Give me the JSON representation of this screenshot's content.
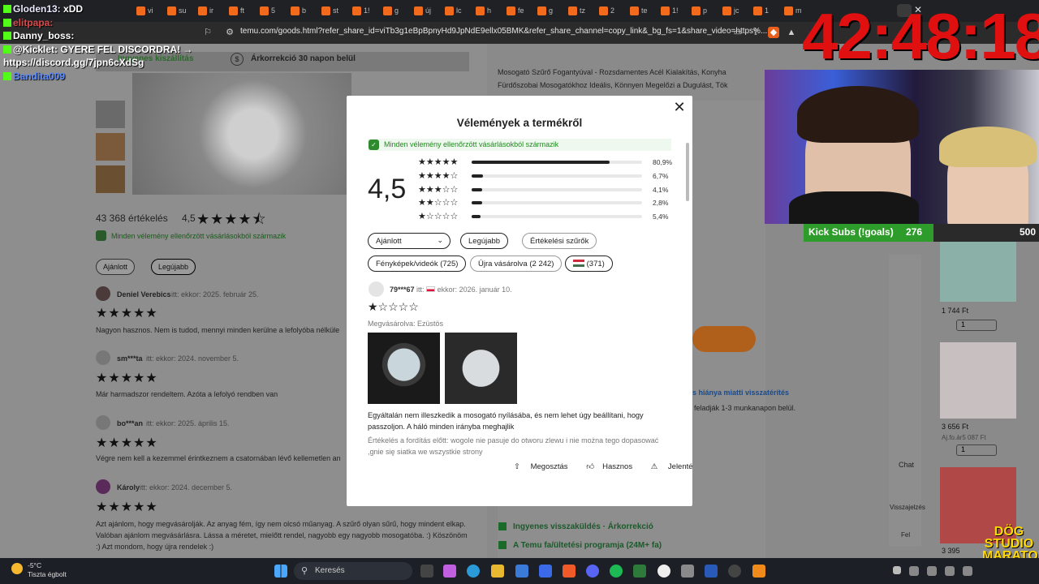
{
  "browser": {
    "tabs": [
      "vi",
      "su",
      "ir",
      "ft",
      "5",
      "b",
      "st",
      "1!",
      "g",
      "új",
      "lc",
      "h",
      "fe",
      "g",
      "tz",
      "2",
      "te",
      "1!",
      "p",
      "jc",
      "1",
      "m"
    ],
    "url": "temu.com/goods.html?refer_share_id=viTb3g1eBpBpnyHd9JpNdE9ellx05BMK&refer_share_channel=copy_link&_bg_fs=1&share_video=https%..."
  },
  "page_bg": {
    "shipping": "Ingyenes kiszállítás",
    "price_adjust": "Árkorrekció 30 napon belül",
    "desc_line1": "Mosogató Szűrő Fogantyúval - Rozsdamentes Acél Kialakítás, Konyha",
    "desc_line2": "Fürdőszobai Mosogatókhoz Ideális, Könnyen Megelőzi a Dugulást, Tök",
    "ratings_count": "43 368 értékelés",
    "rating_value": "4,5",
    "verified_note": "Minden vélemény ellenőrzött vásárlásokból származik",
    "filter_recommended": "Ajánlott",
    "filter_latest": "Legújabb",
    "reviews": [
      {
        "user": "Deniel Verebics",
        "meta": "itt:  ekkor: 2025. február 25.",
        "text": "Nagyon hasznos. Nem is tudod, mennyi minden kerülne a lefolyóba nélküle"
      },
      {
        "user": "sm***ta",
        "meta": "itt:  ekkor: 2024. november 5.",
        "text": "Már harmadszor rendeltem. Azóta a lefolyó rendben van"
      },
      {
        "user": "bo***an",
        "meta": "itt:  ekkor: 2025. április 15.",
        "text": "Végre nem kell a kezemmel érintkeznem a csatornában lévő kellemetlen an"
      },
      {
        "user": "Károly",
        "meta": "itt:  ekkor: 2024. december 5.",
        "text": "Azt ajánlom, hogy megvásárolják. Az anyag fém, így nem olcsó műanyag. A szűrő olyan sűrű, hogy mindent elkap. Valóban ajánlom megvásárlásra. Lássa a méretet, mielőtt rendel, nagyobb egy nagyobb mosogatóba. :) Köszönöm :) Azt mondom, hogy újra rendelek :)"
      }
    ],
    "free_return": "Ingyenes visszaküldés · Árkorrekció",
    "affiliate": "A Temu fa/ültetési programja (24M+ fa)",
    "return_note": "s hiánya miatti visszatérítés",
    "return_sub": "feladják 1-3 munkanapon belül.",
    "side_prices": [
      "1 744 Ft",
      "3 656 Ft",
      "3 395"
    ],
    "side_old_price": "Aj.fo.ár5 087 Ft",
    "qty": "1",
    "side_buttons": [
      "Chat",
      "Visszajelzés",
      "Fel"
    ]
  },
  "stream": {
    "chat": [
      {
        "name": "Gloden13:",
        "msg": "xDD"
      },
      {
        "name": "elitpapa:",
        "msg": ""
      },
      {
        "name": "Danny_boss:",
        "msg": ""
      },
      {
        "name": "@Kicklet:",
        "msg": "GYERE FEL DISCORDRA! →"
      },
      {
        "name": "",
        "msg": "https://discord.gg/7jpn6cXdSg"
      },
      {
        "name": "Bandita009",
        "msg": ""
      }
    ],
    "timer": "42:48:18",
    "subs_label": "Kick Subs (!goals)",
    "subs_current": "276",
    "subs_goal": "500",
    "subs_fraction": 0.552,
    "watermark": "DÖG STUDIO MARATON"
  },
  "modal": {
    "title": "Vélemények a termékről",
    "verified": "Minden vélemény ellenőrzött vásárlásokból származik",
    "score": "4,5",
    "distribution": [
      {
        "stars": "★★★★★",
        "pct": "80,9%",
        "value": 0.809
      },
      {
        "stars": "★★★★☆",
        "pct": "6,7%",
        "value": 0.067
      },
      {
        "stars": "★★★☆☆",
        "pct": "4,1%",
        "value": 0.041
      },
      {
        "stars": "★★☆☆☆",
        "pct": "2,8%",
        "value": 0.028
      },
      {
        "stars": "★☆☆☆☆",
        "pct": "5,4%",
        "value": 0.054
      }
    ],
    "filters": {
      "recommended": "Ajánlott",
      "latest": "Legújabb",
      "rating_filters": "Értékelési szűrők",
      "photos": "Fényképek/videók (725)",
      "rebuy": "Újra vásárolva (2 242)",
      "country_count": "(371)"
    },
    "review": {
      "user": "79***67",
      "meta_prefix": "itt:",
      "meta_date": "ekkor: 2026. január 10.",
      "stars": "★☆☆☆☆",
      "variant": "Megvásárolva: Ezüstös",
      "text": "Egyáltalán nem illeszkedik a mosogató nyílásába, és nem lehet úgy beállítani, hogy passzoljon. A háló minden irányba meghajlik",
      "original_label": "Értékelés a fordítás előtt:",
      "original": "wogole nie pasuje do otworu zlewu i nie można tego dopasować ,gnie się siatka we wszystkie strony",
      "share": "Megosztás",
      "helpful": "Hasznos",
      "report": "Jelentés"
    }
  },
  "taskbar": {
    "temp": "-5°C",
    "weather": "Tiszta égbolt",
    "search": "Keresés"
  }
}
